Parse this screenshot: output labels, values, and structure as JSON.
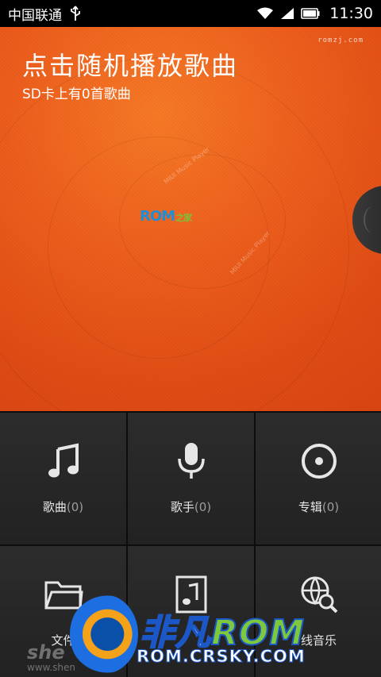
{
  "status_bar": {
    "carrier": "中国联通",
    "time": "11:30"
  },
  "hero": {
    "title": "点击随机播放歌曲",
    "subtitle": "SD卡上有0首歌曲",
    "watermark": "romzj.com",
    "disc_logo_main": "ROM",
    "disc_logo_sub": "之家",
    "disc_caption_1": "MIUI Music Player",
    "disc_caption_2": "MIUI Music Player"
  },
  "tiles": [
    {
      "label": "歌曲",
      "count": "(0)",
      "icon": "music-note-icon"
    },
    {
      "label": "歌手",
      "count": "(0)",
      "icon": "microphone-icon"
    },
    {
      "label": "专辑",
      "count": "(0)",
      "icon": "disc-icon"
    },
    {
      "label": "文件",
      "count": "",
      "icon": "folder-icon"
    },
    {
      "label": "",
      "count": "",
      "icon": "music-file-icon"
    },
    {
      "label": "线音乐",
      "count": "",
      "icon": "online-search-icon"
    }
  ],
  "overlay": {
    "brand_cn": "非凡",
    "brand_rom": "ROM",
    "brand_url": "ROM.CRSKY.COM",
    "she_mark": "she",
    "she_url": "www.shen"
  }
}
